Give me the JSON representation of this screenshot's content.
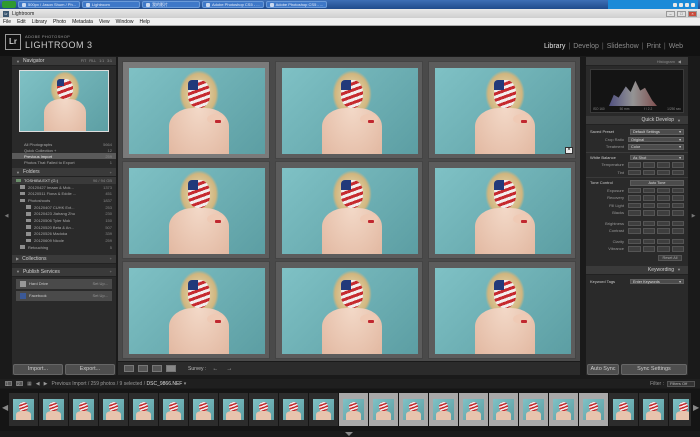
{
  "taskbar": {
    "items": [
      {
        "label": "500px / Jason Shum / Ph..."
      },
      {
        "label": "Lightroom"
      },
      {
        "label": "我的影片"
      },
      {
        "label": "Adobe Photoshop CS5 - ..."
      },
      {
        "label": "Adobe Photoshop CS5 - ..."
      }
    ]
  },
  "titlebar": {
    "title": "Lightroom"
  },
  "menu": [
    "File",
    "Edit",
    "Library",
    "Photo",
    "Metadata",
    "View",
    "Window",
    "Help"
  ],
  "identity": {
    "badge": "Lr",
    "adobe": "ADOBE PHOTOSHOP",
    "product": "LIGHTROOM 3"
  },
  "modules": [
    {
      "label": "Library",
      "active": true
    },
    {
      "label": "Develop"
    },
    {
      "label": "Slideshow"
    },
    {
      "label": "Print"
    },
    {
      "label": "Web"
    }
  ],
  "left": {
    "navigator": {
      "title": "Navigator",
      "opts": [
        "FIT",
        "FILL",
        "1:1",
        "3:1"
      ]
    },
    "catalog": [
      {
        "label": "All Photographs",
        "count": "5664"
      },
      {
        "label": "Quick Collection +",
        "count": "12"
      },
      {
        "label": "Previous Import",
        "count": "259",
        "selected": true
      },
      {
        "label": "Photos That Failed to Export",
        "count": "1"
      }
    ],
    "folders_title": "Folders",
    "volume": {
      "label": "TOSHIBA EXT (G:)",
      "count": "96 / 94 GB"
    },
    "folders": [
      {
        "label": "20120427 Imaan & Mok...",
        "count": "1373"
      },
      {
        "label": "20120511 Fiona & Eddie ...",
        "count": "451"
      },
      {
        "label": "Photoshoots",
        "count": "1837"
      },
      {
        "label": "20120407 CUHK Ext...",
        "count": "253",
        "sub": true
      },
      {
        "label": "20120423 Jiahang Zhu",
        "count": "230",
        "sub": true
      },
      {
        "label": "20120506 Tyler Mok",
        "count": "150",
        "sub": true
      },
      {
        "label": "20120520 Beta & An...",
        "count": "507",
        "sub": true
      },
      {
        "label": "20120526 Madoka",
        "count": "339",
        "sub": true
      },
      {
        "label": "20120609 Nicole",
        "count": "259",
        "sub": true
      },
      {
        "label": "Retouching",
        "count": "5"
      }
    ],
    "collections_title": "Collections",
    "publish_title": "Publish Services",
    "publish": [
      {
        "label": "Hard Drive",
        "action": "Set Up..."
      },
      {
        "label": "Facebook",
        "action": "Set Up..."
      }
    ],
    "import_label": "Import...",
    "export_label": "Export..."
  },
  "toolbar": {
    "survey_label": "Survey :"
  },
  "right": {
    "histogram_title": "Histogram",
    "histo_meta": [
      "ISO 160",
      "50 mm",
      "f / 2.2",
      "1/250 sec"
    ],
    "quick_develop_title": "Quick Develop",
    "saved_preset": {
      "label": "Saved Preset",
      "value": "Default Settings"
    },
    "crop_ratio": {
      "label": "Crop Ratio",
      "value": "Original"
    },
    "treatment": {
      "label": "Treatment",
      "value": "Color"
    },
    "white_balance": {
      "label": "White Balance",
      "value": "As Shot"
    },
    "temperature": "Temperature",
    "tint": "Tint",
    "tone_control": {
      "label": "Tone Control",
      "value": "Auto Tone"
    },
    "tone_rows": [
      "Exposure",
      "Recovery",
      "Fill Light",
      "Blacks",
      "Brightness",
      "Contrast",
      "Clarity",
      "Vibrance"
    ],
    "reset_label": "Reset All",
    "keywording_title": "Keywording",
    "keyword_tags": {
      "label": "Keyword Tags",
      "value": "Enter Keywords"
    },
    "auto_sync_label": "Auto Sync",
    "sync_settings_label": "Sync Settings"
  },
  "filmhead": {
    "page1": "1",
    "page2": "2",
    "path": "Previous Import / 259 photos / 9 selected /",
    "file": "DSC_9866.NEF",
    "filter_label": "Filter :",
    "filter_value": "Filters Off"
  }
}
